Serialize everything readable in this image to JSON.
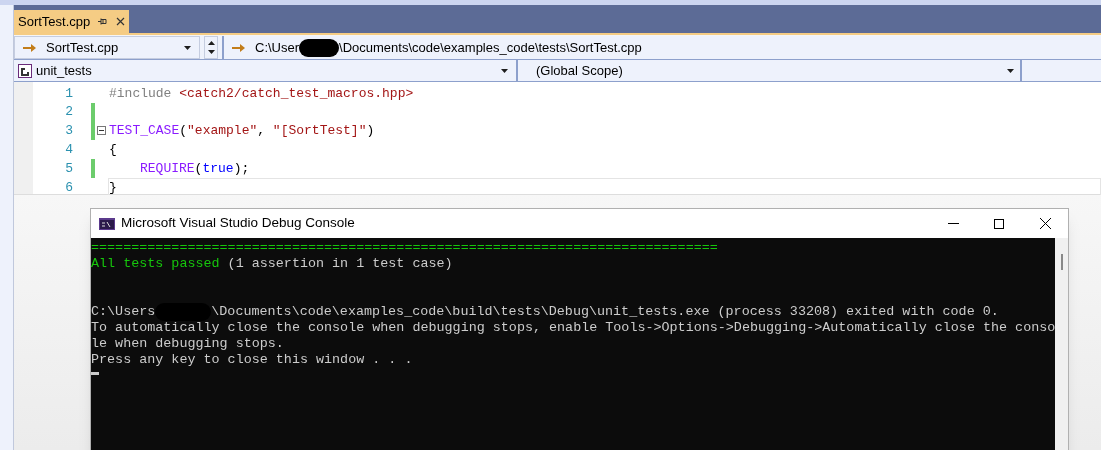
{
  "document_tab": {
    "title": "SortTest.cpp",
    "selected": true
  },
  "navigation_bar": {
    "file": "SortTest.cpp",
    "path": [
      {
        "kind": "text",
        "text": "C:\\User"
      },
      {
        "kind": "redacted"
      },
      {
        "kind": "text",
        "text": "\\Documents\\code\\examples_code\\tests\\SortTest.cpp"
      }
    ]
  },
  "scope_bar": {
    "project": "unit_tests",
    "scope": "(Global Scope)"
  },
  "editor": {
    "lines": [
      {
        "number": "1",
        "changed": false,
        "foldable": false,
        "current": false,
        "indented": false,
        "tokens": [
          {
            "kind": "preprocessor",
            "text": "#include "
          },
          {
            "kind": "string",
            "text": "<catch2/catch_test_macros.hpp>"
          }
        ]
      },
      {
        "number": "2",
        "changed": true,
        "foldable": false,
        "current": false
      },
      {
        "number": "3",
        "changed": true,
        "foldable": true,
        "current": false,
        "indented": false,
        "tokens": [
          {
            "kind": "macro",
            "text": "TEST_CASE"
          },
          {
            "kind": "plain",
            "text": "("
          },
          {
            "kind": "string",
            "text": "\"example\""
          },
          {
            "kind": "plain",
            "text": ", "
          },
          {
            "kind": "string",
            "text": "\"[SortTest]\""
          },
          {
            "kind": "plain",
            "text": ")"
          }
        ]
      },
      {
        "number": "4",
        "changed": false,
        "foldable": false,
        "current": false,
        "indented": false,
        "tokens": [
          {
            "kind": "plain",
            "text": "{"
          }
        ]
      },
      {
        "number": "5",
        "changed": true,
        "foldable": false,
        "current": false,
        "indented": true,
        "tokens": [
          {
            "kind": "macro",
            "text": "REQUIRE"
          },
          {
            "kind": "plain",
            "text": "("
          },
          {
            "kind": "keyword",
            "text": "true"
          },
          {
            "kind": "plain",
            "text": ");"
          }
        ]
      },
      {
        "number": "6",
        "changed": false,
        "foldable": false,
        "current": true,
        "indented": false,
        "tokens": [
          {
            "kind": "plain",
            "text": "}"
          }
        ]
      }
    ]
  },
  "console_window": {
    "title": "Microsoft Visual Studio Debug Console",
    "blocks": [
      {
        "lines": [
          [
            {
              "kind": "green",
              "text": "=============================================================================="
            }
          ],
          [
            {
              "kind": "green",
              "text": "All tests passed"
            },
            {
              "kind": "plain",
              "text": " (1 assertion in 1 test case)"
            }
          ]
        ]
      },
      {
        "lines": [
          [
            {
              "kind": "plain",
              "text": "C:\\Users"
            },
            {
              "kind": "redacted"
            },
            {
              "kind": "plain",
              "text": "\\Documents\\code\\examples_code\\build\\tests\\Debug\\unit_tests.exe (process 33208) exited with code 0."
            }
          ],
          [
            {
              "kind": "plain",
              "text": "To automatically close the console when debugging stops, enable Tools->Options->Debugging->Automatically close the conso"
            }
          ],
          [
            {
              "kind": "plain",
              "text": "le when debugging stops."
            }
          ],
          [
            {
              "kind": "plain",
              "text": "Press any key to close this window . . ."
            }
          ]
        ]
      }
    ]
  }
}
